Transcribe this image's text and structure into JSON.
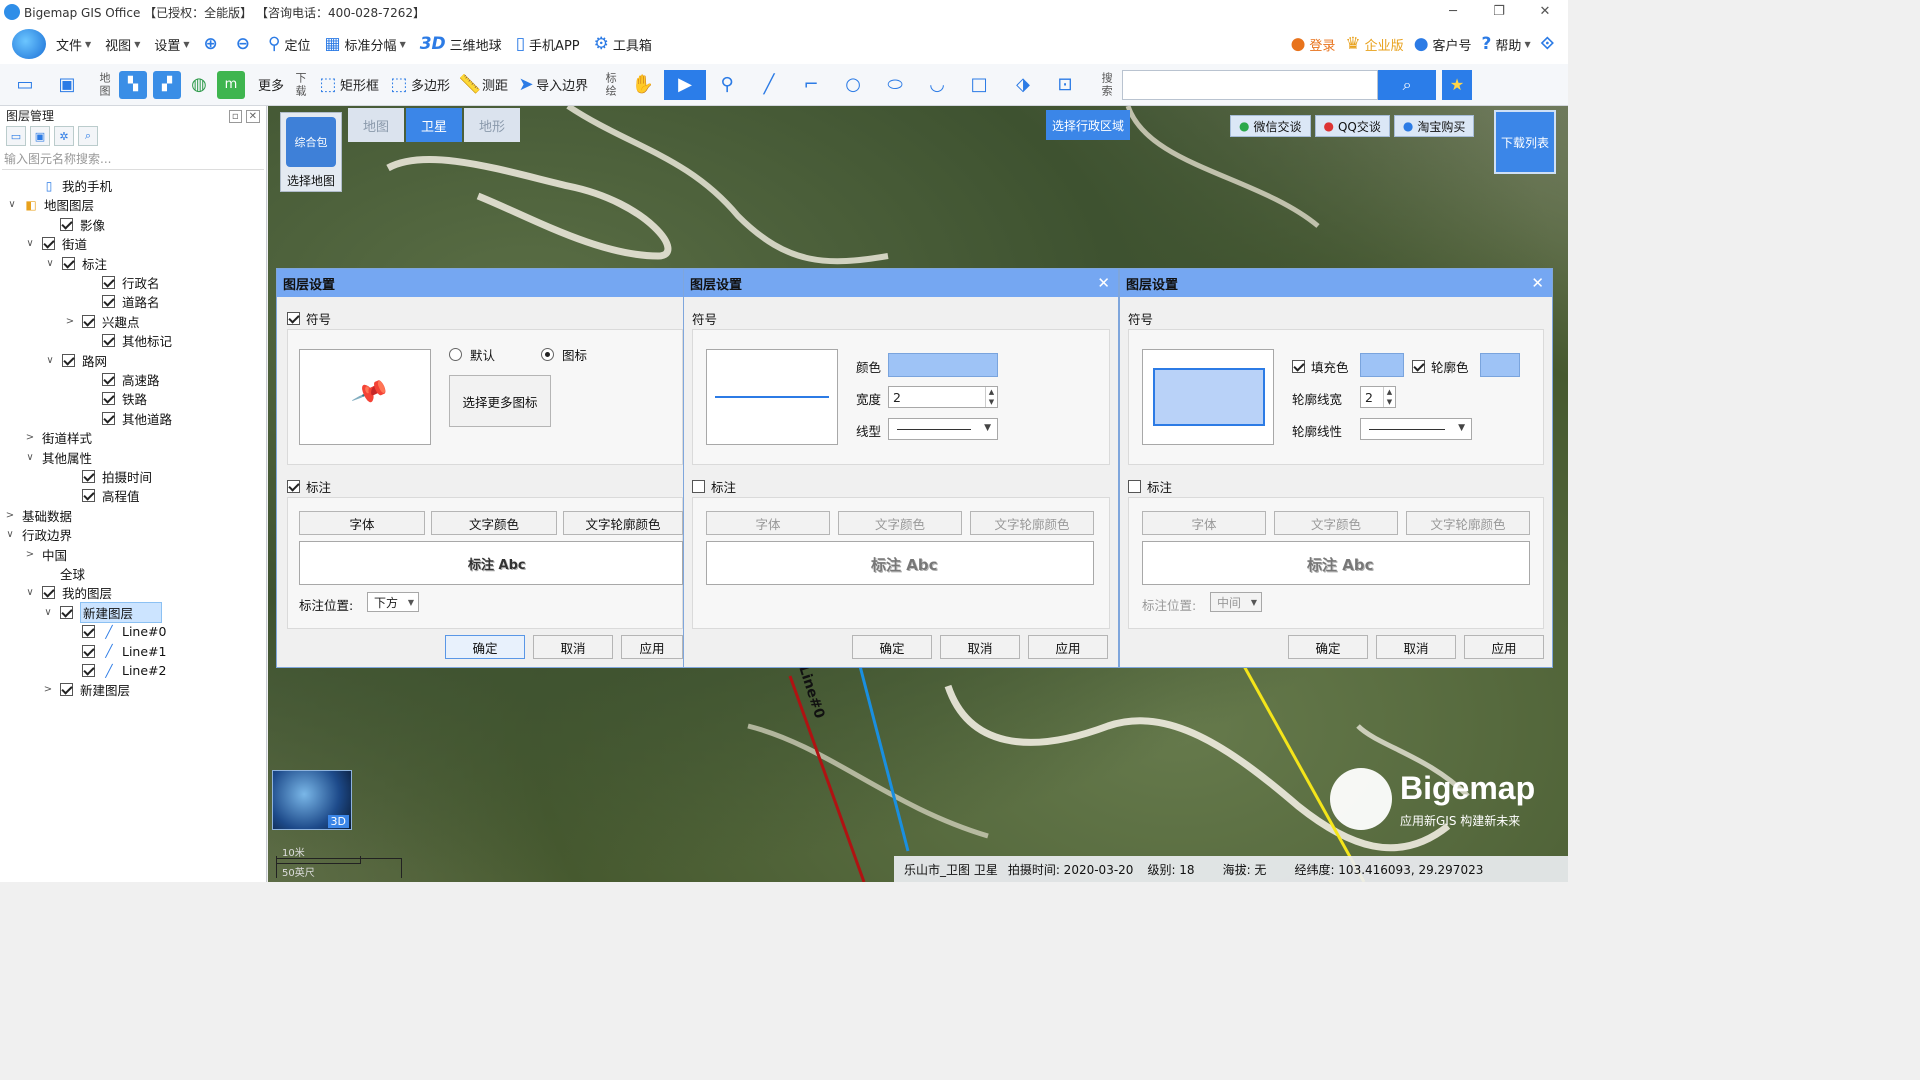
{
  "window": {
    "title": "Bigemap GIS Office 【已授权：全能版】 【咨询电话：400-028-7262】",
    "controls": [
      "─",
      "❐",
      "✕"
    ]
  },
  "menu": {
    "file": "文件",
    "view": "视图",
    "settings": "设置",
    "locate": "定位",
    "standard_sheet": "标准分幅",
    "three_d_badge": "3D",
    "globe": "三维地球",
    "mobile_app": "手机APP",
    "toolbox": "工具箱",
    "login": "登录",
    "enterprise": "企业版",
    "customer_id": "客户号",
    "help": "帮助"
  },
  "toolbar": {
    "map_label": "地图",
    "more": "更多",
    "download_label": "下载",
    "rect": "矩形框",
    "polygon": "多边形",
    "measure": "测距",
    "import_boundary": "导入边界",
    "annotate_label": "标绘",
    "search_label": "搜索",
    "search_placeholder": ""
  },
  "left_panel": {
    "title": "图层管理",
    "search_placeholder": "输入图元名称搜索...",
    "tree": [
      {
        "label": "我的手机",
        "toggle": "",
        "checkbox": false,
        "icon": "phone"
      },
      {
        "label": "地图图层",
        "toggle": "∨",
        "checkbox": false,
        "icon": "layers"
      },
      {
        "label": "影像",
        "toggle": "",
        "checkbox": true
      },
      {
        "label": "街道",
        "toggle": "∨",
        "checkbox": true
      },
      {
        "label": "标注",
        "toggle": "∨",
        "checkbox": true
      },
      {
        "label": "行政名",
        "toggle": "",
        "checkbox": true
      },
      {
        "label": "道路名",
        "toggle": "",
        "checkbox": true
      },
      {
        "label": "兴趣点",
        "toggle": ">",
        "checkbox": true
      },
      {
        "label": "其他标记",
        "toggle": "",
        "checkbox": true
      },
      {
        "label": "路网",
        "toggle": "∨",
        "checkbox": true
      },
      {
        "label": "高速路",
        "toggle": "",
        "checkbox": true
      },
      {
        "label": "铁路",
        "toggle": "",
        "checkbox": true
      },
      {
        "label": "其他道路",
        "toggle": "",
        "checkbox": true
      },
      {
        "label": "街道样式",
        "toggle": ">",
        "checkbox": false
      },
      {
        "label": "其他属性",
        "toggle": "∨",
        "checkbox": false
      },
      {
        "label": "拍摄时间",
        "toggle": "",
        "checkbox": true
      },
      {
        "label": "高程值",
        "toggle": "",
        "checkbox": true
      },
      {
        "label": "基础数据",
        "toggle": ">",
        "checkbox": false
      },
      {
        "label": "行政边界",
        "toggle": "∨",
        "checkbox": false
      },
      {
        "label": "中国",
        "toggle": ">",
        "checkbox": false
      },
      {
        "label": "全球",
        "toggle": "",
        "checkbox": false
      },
      {
        "label": "我的图层",
        "toggle": "∨",
        "checkbox": true
      },
      {
        "label": "新建图层",
        "toggle": "∨",
        "checkbox": true,
        "selected": true
      },
      {
        "label": "Line#0",
        "toggle": "",
        "checkbox": true,
        "icon": "line"
      },
      {
        "label": "Line#1",
        "toggle": "",
        "checkbox": true,
        "icon": "line"
      },
      {
        "label": "Line#2",
        "toggle": "",
        "checkbox": true,
        "icon": "line"
      },
      {
        "label": "新建图层",
        "toggle": ">",
        "checkbox": true
      }
    ]
  },
  "map": {
    "selector_thumb": "综合包",
    "selector_label": "选择地图",
    "tabs": [
      "地图",
      "卫星",
      "地形"
    ],
    "active_tab": "卫星",
    "region_button": "选择行政区域",
    "socials": [
      "微信交谈",
      "QQ交谈",
      "淘宝购买"
    ],
    "download_list": "下载列表",
    "minimap_badge": "3D",
    "scale_top": "10米",
    "scale_bottom": "50英尺",
    "line_label": "Line#0",
    "brand_name": "Bigemap",
    "brand_slogan": "应用新GIS 构建新未来",
    "status": {
      "place": "乐山市_卫图 卫星",
      "capture_time": "拍摄时间: 2020-03-20",
      "level": "级别:  18",
      "altitude": "海拔: 无",
      "coords": "经纬度:   103.416093, 29.297023"
    }
  },
  "dialogs": {
    "common": {
      "title": "图层设置",
      "symbol": "符号",
      "label": "标注",
      "font": "字体",
      "text_color": "文字颜色",
      "text_outline_color": "文字轮廓颜色",
      "label_position": "标注位置:",
      "ok": "确定",
      "cancel": "取消",
      "apply": "应用",
      "sample_text": "标注  Abc"
    },
    "point": {
      "radio_default": "默认",
      "radio_icon": "图标",
      "more_icons": "选择更多图标",
      "position_value": "下方"
    },
    "line": {
      "color": "颜色",
      "width": "宽度",
      "width_value": "2",
      "line_type": "线型",
      "line_color": "#9ec3f6"
    },
    "polygon": {
      "fill_color": "填充色",
      "outline_color": "轮廓色",
      "outline_width": "轮廓线宽",
      "outline_width_value": "2",
      "outline_type": "轮廓线性",
      "position_value": "中间"
    }
  }
}
